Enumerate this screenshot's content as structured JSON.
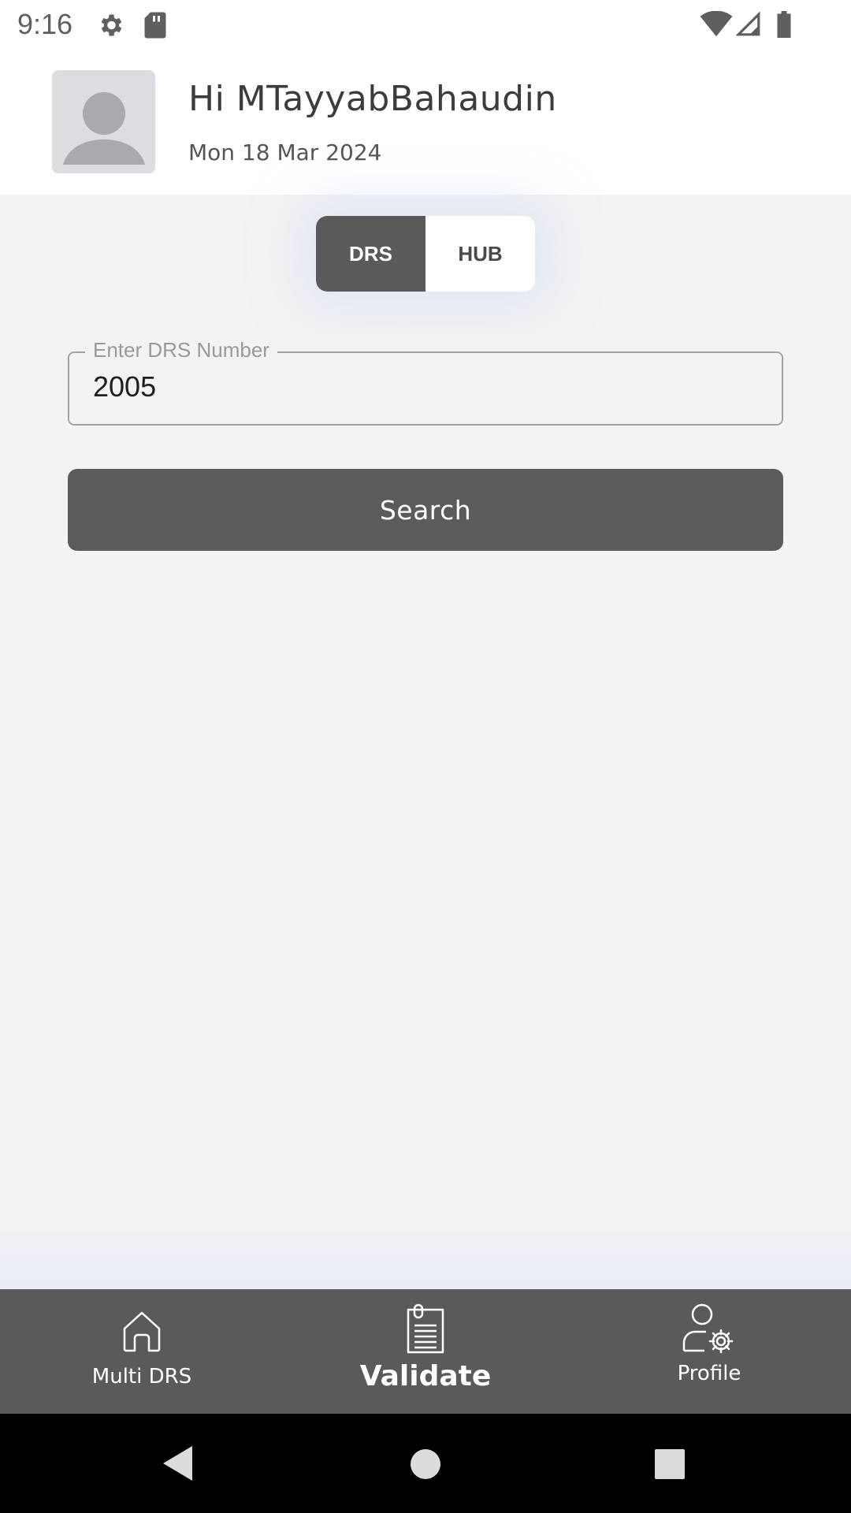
{
  "status_bar": {
    "time": "9:16",
    "icons": [
      "gear-icon",
      "sd-card-icon",
      "wifi-icon",
      "cell-signal-icon",
      "battery-icon"
    ]
  },
  "header": {
    "greeting": "Hi MTayyabBahaudin",
    "date": "Mon 18 Mar 2024"
  },
  "toggle": {
    "options": [
      "DRS",
      "HUB"
    ],
    "selected": "DRS"
  },
  "drs_field": {
    "label": "Enter DRS Number",
    "value": "2005"
  },
  "search": {
    "label": "Search"
  },
  "bottom_nav": {
    "items": [
      {
        "label": "Multi DRS",
        "icon": "home-icon"
      },
      {
        "label": "Validate",
        "icon": "document-icon",
        "active": true
      },
      {
        "label": "Profile",
        "icon": "user-settings-icon"
      }
    ]
  },
  "colors": {
    "primary_dark": "#5a5a5a",
    "background": "#f3f3f3",
    "header_bg": "#ffffff"
  }
}
